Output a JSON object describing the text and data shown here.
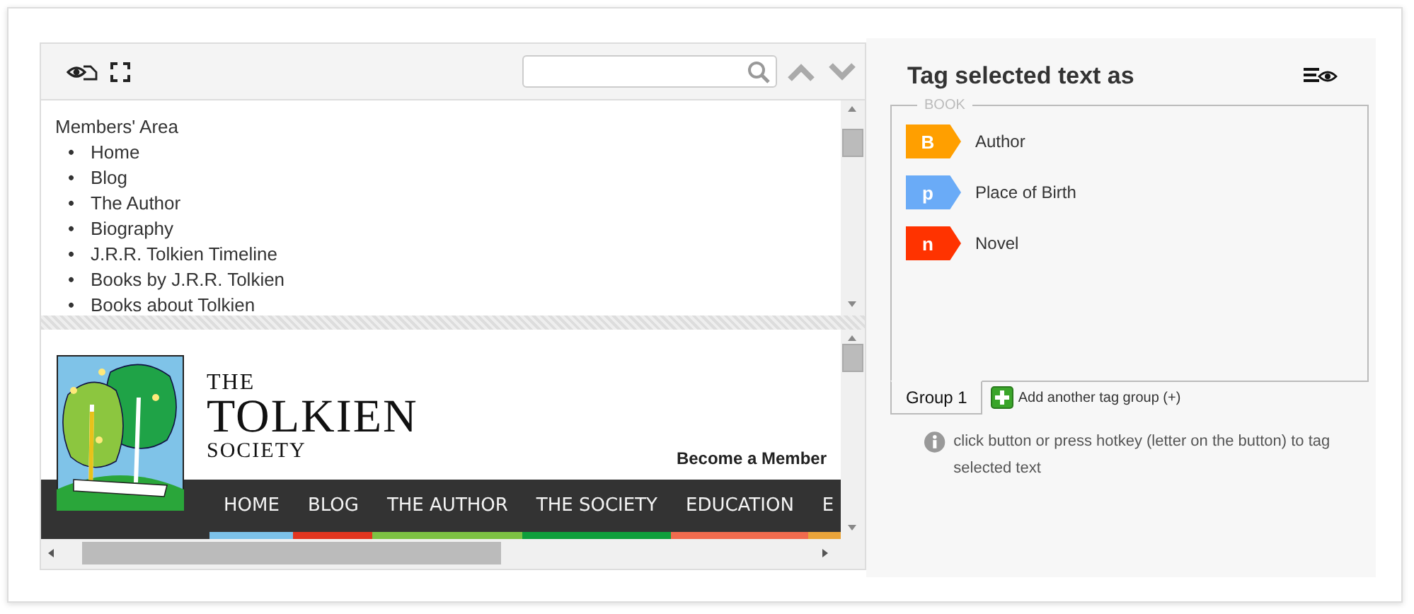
{
  "upper_pane": {
    "heading": "Members' Area",
    "bullet": "•",
    "items": [
      "Home",
      "Blog",
      "The Author",
      "Biography",
      "J.R.R. Tolkien Timeline",
      "Books by J.R.R. Tolkien",
      "Books about Tolkien"
    ]
  },
  "lower_pane": {
    "site_title": {
      "top": "THE",
      "main": "TOLKIEN",
      "bottom": "SOCIETY"
    },
    "member_link": "Become a Member",
    "nav": [
      {
        "label": "HOME",
        "color": "#7cc1e8"
      },
      {
        "label": "BLOG",
        "color": "#e2351f"
      },
      {
        "label": "THE AUTHOR",
        "color": "#7dc243"
      },
      {
        "label": "THE SOCIETY",
        "color": "#0e9f3b"
      },
      {
        "label": "EDUCATION",
        "color": "#f26b4e"
      },
      {
        "label": "E",
        "color": "#e9a43a"
      }
    ]
  },
  "tag_panel": {
    "title": "Tag selected text as",
    "group_legend": "BOOK",
    "tags": [
      {
        "key": "B",
        "label": "Author",
        "color": "#ff9f00"
      },
      {
        "key": "p",
        "label": "Place of Birth",
        "color": "#6aabf7"
      },
      {
        "key": "n",
        "label": "Novel",
        "color": "#ff3300"
      }
    ],
    "groups": [
      {
        "label": "Group 1",
        "selected": true
      }
    ],
    "add_group": "Add another tag group (+)",
    "hint": "click button or press hotkey (letter on the button) to tag selected text"
  }
}
